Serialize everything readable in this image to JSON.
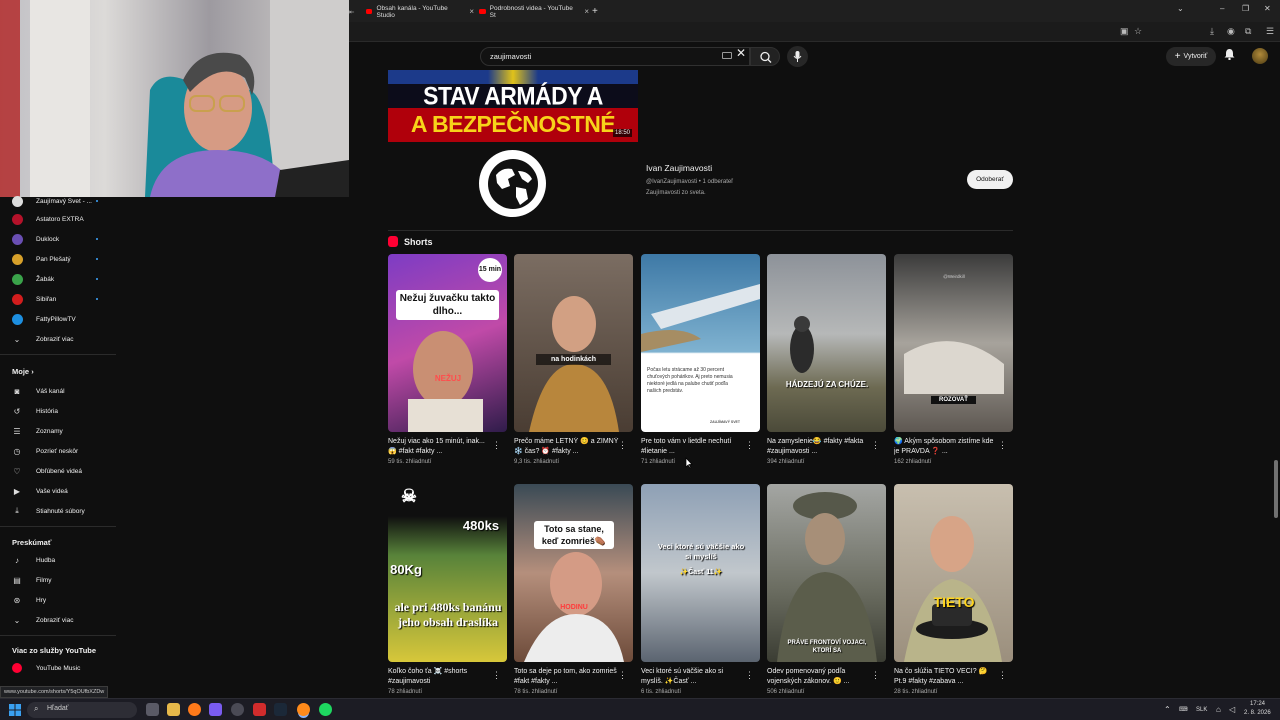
{
  "browser": {
    "tabs": [
      {
        "label": "Obsah kanála - YouTube Studio"
      },
      {
        "label": "Podrobnosti videa - YouTube St"
      }
    ],
    "new_tab": "+"
  },
  "header": {
    "search_value": "zaujimavosti",
    "create_label": "Vytvoriť"
  },
  "sidebar": {
    "subscriptions": [
      {
        "label": "Zaujímavý Svet - ...",
        "color": "#dddddd"
      },
      {
        "label": "Astatoro EXTRA",
        "color": "#b5122a"
      },
      {
        "label": "Duklock",
        "color": "#6a4fb3"
      },
      {
        "label": "Pan Plešatý",
        "color": "#d7a02a"
      },
      {
        "label": "Žabák",
        "color": "#3aa34a"
      },
      {
        "label": "Sibiřan",
        "color": "#d21d1d"
      },
      {
        "label": "FattyPillowTV",
        "color": "#1d8fe0"
      }
    ],
    "show_more": "Zobraziť viac",
    "you_heading": "Moje",
    "you_items": [
      {
        "label": "Váš kanál",
        "icon": "channel-icon"
      },
      {
        "label": "História",
        "icon": "history-icon"
      },
      {
        "label": "Zoznamy",
        "icon": "playlists-icon"
      },
      {
        "label": "Pozrieť neskôr",
        "icon": "watch-later-icon"
      },
      {
        "label": "Obľúbené videá",
        "icon": "liked-icon"
      },
      {
        "label": "Vaše videá",
        "icon": "your-videos-icon"
      },
      {
        "label": "Stiahnuté súbory",
        "icon": "downloads-icon"
      }
    ],
    "explore_heading": "Preskúmať",
    "explore_items": [
      {
        "label": "Hudba",
        "icon": "music-icon"
      },
      {
        "label": "Filmy",
        "icon": "movies-icon"
      },
      {
        "label": "Hry",
        "icon": "gaming-icon"
      }
    ],
    "explore_more": "Zobraziť viac",
    "more_heading": "Viac zo služby YouTube",
    "more_items": [
      {
        "label": "YouTube Music"
      }
    ]
  },
  "banner": {
    "line1": "STAV ARMÁDY A POLÍCIE SR",
    "line2": "A BEZPEČNOSTNÉ HROZBY",
    "duration": "18:50"
  },
  "channel": {
    "name": "Ivan Zaujimavosti",
    "meta": "@IvanZaujimavosti • 1 odberateľ",
    "description": "Zaujímavosti zo sveta.",
    "subscribe_label": "Odoberať"
  },
  "shorts": {
    "heading": "Shorts",
    "row1": [
      {
        "title": "Nežuj viac ako 15 minút, inak... 😱 #fakt #fakty ...",
        "views": "59 tis. zhliadnutí",
        "caption": "Nežuj žuvačku takto dlho...",
        "badge": "15 min",
        "sub": "NEŽUJ"
      },
      {
        "title": "Prečo máme LETNÝ 😊 a ZIMNÝ ❄️ čas? ⏰ #fakty ...",
        "views": "9,3 tis. zhliadnutí",
        "caption": "na hodinkách",
        "sub": ""
      },
      {
        "title": "Pre toto vám v lietdle nechutí #lietanie ...",
        "views": "71 zhliadnutí",
        "caption": "Počas letu strácame až 30 percent chuťových pohárikov. Aj preto nemusia niektoré jedlá na palube chutiť podľa našich predstáv.",
        "sub": "ZAUJÍMAVÝ SVET"
      },
      {
        "title": "Na zamyslenie😂 #fakty #fakta #zaujimavosti ...",
        "views": "394 zhliadnutí",
        "caption": "HÁDZEJÚ ZA CHÚZE.",
        "sub": ""
      },
      {
        "title": "🌍 Akým spôsobom zistíme kde je PRAVDA ❓ ...",
        "views": "162 zhliadnutí",
        "caption": "ROZOVAŤ",
        "sub": "@Weirdkill"
      }
    ],
    "row2": [
      {
        "title": "Koľko čoho ťa ☠️ #shorts #zaujimavosti",
        "views": "78 zhliadnutí",
        "caption": "ale pri 480ks banánu jeho obsah draslíka",
        "badge": "480ks",
        "sub": "80Kg"
      },
      {
        "title": "Toto sa deje po tom, ako zomrieš #fakt #fakty ...",
        "views": "78 tis. zhliadnutí",
        "caption": "Toto sa stane, keď zomrieš⚰️",
        "sub": "HODINU"
      },
      {
        "title": "Veci ktoré sú väčšie ako si myslíš. ✨Časť ...",
        "views": "6 tis. zhliadnutí",
        "caption": "Veci ktoré sú väčšie ako si myslíš",
        "sub": "✨Časť 11✨"
      },
      {
        "title": "Odev pomenovaný podľa vojenských zákonov. 🙂 ...",
        "views": "506 zhliadnutí",
        "caption": "PRÁVE FRONTOVÍ VOJACI, KTORÍ SA",
        "sub": ""
      },
      {
        "title": "Na čo slúžia TIETO VECI? 🤔 Pt.9 #fakty #zabava ...",
        "views": "28 tis. zhliadnutí",
        "caption": "TIETO",
        "sub": ""
      }
    ]
  },
  "status_url": "www.youtube.com/shorts/Y5qOUfbXZDw",
  "taskbar": {
    "search_placeholder": "Hľadať",
    "lang": "SLK",
    "time": "17:24",
    "date": "2. 8. 2026"
  }
}
